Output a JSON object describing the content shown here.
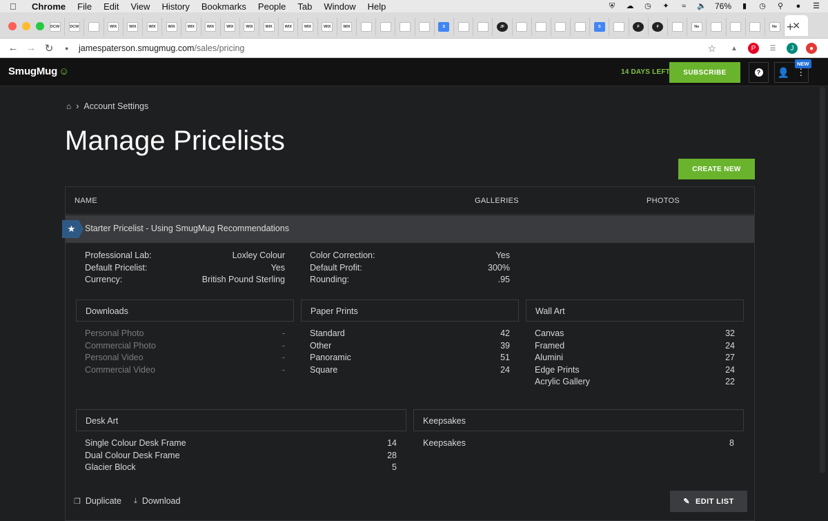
{
  "menubar": {
    "app": "Chrome",
    "items": [
      "File",
      "Edit",
      "View",
      "History",
      "Bookmarks",
      "People",
      "Tab",
      "Window",
      "Help"
    ],
    "battery": "76%"
  },
  "browser": {
    "tabs": [
      "DCW",
      "DCW",
      "",
      "WIX",
      "WIX",
      "WIX",
      "WIX",
      "WIX",
      "WIX",
      "WIX",
      "WIX",
      "WIX",
      "WIX",
      "WIX",
      "WIX",
      "WIX",
      "",
      "",
      "",
      "",
      "S",
      "",
      "",
      "JF",
      "",
      "",
      "",
      "",
      "S",
      "",
      "F",
      "F",
      "",
      "Ne",
      "",
      "",
      "",
      "Ne"
    ],
    "url_host": "jamespaterson.smugmug.com",
    "url_path": "/sales/pricing"
  },
  "header": {
    "logo": "SmugMug",
    "days_left": "14 DAYS LEFT",
    "subscribe": "SUBSCRIBE",
    "help": "?",
    "new_badge": "NEW"
  },
  "breadcrumb": {
    "item": "Account Settings"
  },
  "page": {
    "title": "Manage Pricelists",
    "create_new": "CREATE NEW"
  },
  "table": {
    "columns": [
      "NAME",
      "GALLERIES",
      "PHOTOS"
    ],
    "pricelist": {
      "name": "Starter Pricelist - Using SmugMug Recommendations",
      "props_left": [
        {
          "k": "Professional Lab:",
          "v": "Loxley Colour"
        },
        {
          "k": "Default Pricelist:",
          "v": "Yes"
        },
        {
          "k": "Currency:",
          "v": "British Pound Sterling"
        }
      ],
      "props_right": [
        {
          "k": "Color Correction:",
          "v": "Yes"
        },
        {
          "k": "Default Profit:",
          "v": "300%"
        },
        {
          "k": "Rounding:",
          "v": ".95"
        }
      ],
      "categories": {
        "downloads": {
          "title": "Downloads",
          "items": [
            {
              "k": "Personal Photo",
              "v": "-"
            },
            {
              "k": "Commercial Photo",
              "v": "-"
            },
            {
              "k": "Personal Video",
              "v": "-"
            },
            {
              "k": "Commercial Video",
              "v": "-"
            }
          ]
        },
        "paper": {
          "title": "Paper Prints",
          "items": [
            {
              "k": "Standard",
              "v": "42"
            },
            {
              "k": "Other",
              "v": "39"
            },
            {
              "k": "Panoramic",
              "v": "51"
            },
            {
              "k": "Square",
              "v": "24"
            }
          ]
        },
        "wall": {
          "title": "Wall Art",
          "items": [
            {
              "k": "Canvas",
              "v": "32"
            },
            {
              "k": "Framed",
              "v": "24"
            },
            {
              "k": "Alumini",
              "v": "27"
            },
            {
              "k": "Edge Prints",
              "v": "24"
            },
            {
              "k": "Acrylic Gallery",
              "v": "22"
            }
          ]
        },
        "desk": {
          "title": "Desk Art",
          "items": [
            {
              "k": "Single Colour Desk Frame",
              "v": "14"
            },
            {
              "k": "Dual Colour Desk Frame",
              "v": "28"
            },
            {
              "k": "Glacier Block",
              "v": "5"
            }
          ]
        },
        "keepsakes": {
          "title": "Keepsakes",
          "items": [
            {
              "k": "Keepsakes",
              "v": "8"
            }
          ]
        }
      }
    },
    "actions": {
      "duplicate": "Duplicate",
      "download": "Download",
      "edit": "EDIT LIST"
    }
  }
}
